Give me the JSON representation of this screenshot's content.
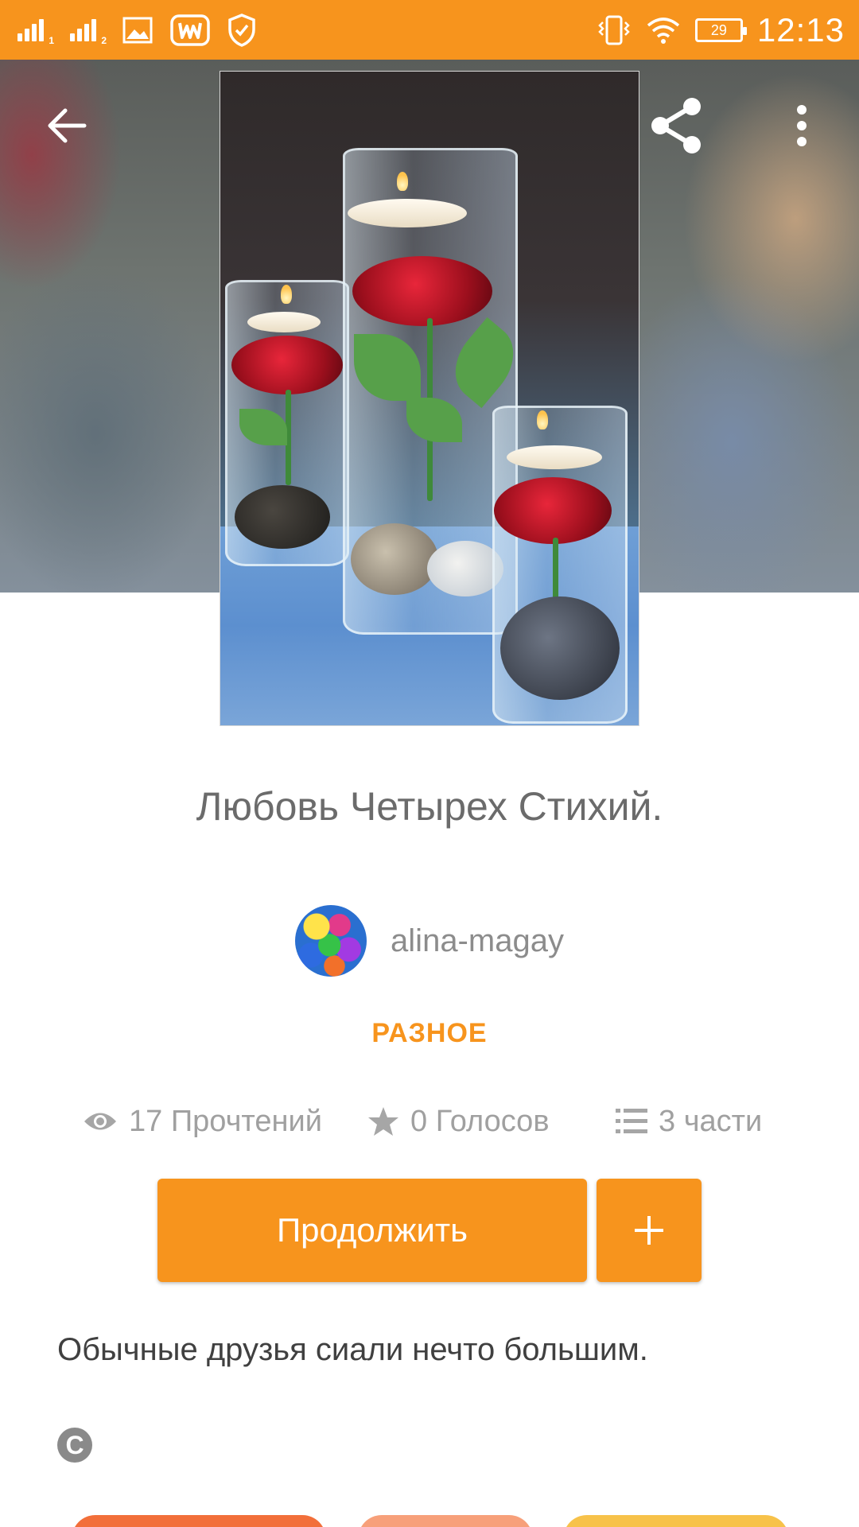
{
  "status_bar": {
    "time": "12:13",
    "battery": "29",
    "icons": [
      "signal-1-icon",
      "signal-2-icon",
      "gallery-icon",
      "wattpad-icon",
      "shield-icon",
      "vibrate-icon",
      "wifi-icon",
      "battery-icon"
    ]
  },
  "header": {
    "back_icon": "arrow-left-icon",
    "share_icon": "share-icon",
    "menu_icon": "more-vertical-icon"
  },
  "story": {
    "title": "Любовь Четырех Стихий.",
    "author": "alina-magay",
    "category": "РАЗНОЕ",
    "reads": "17 Прочтений",
    "votes": "0 Голосов",
    "parts": "3 части",
    "description": "Обычные друзья сиали нечто большим.",
    "copyright_symbol": "C"
  },
  "actions": {
    "continue_label": "Продолжить",
    "add_label": "+"
  },
  "colors": {
    "accent": "#f7941d",
    "tag_colors": [
      "#f26f3a",
      "#f7a07a",
      "#f7c24a"
    ]
  }
}
